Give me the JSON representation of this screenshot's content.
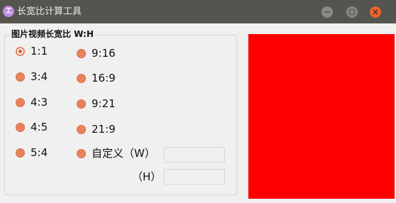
{
  "window": {
    "title": "长宽比计算工具",
    "icon_text": "工",
    "buttons": {
      "minimize_icon": "minimize-icon",
      "maximize_icon": "maximize-icon",
      "close_icon": "close-icon"
    }
  },
  "group": {
    "title": "图片视频长宽比 W:H",
    "options": [
      {
        "label": "1:1",
        "checked": true
      },
      {
        "label": "3:4",
        "checked": false
      },
      {
        "label": "4:3",
        "checked": false
      },
      {
        "label": "4:5",
        "checked": false
      },
      {
        "label": "5:4",
        "checked": false
      },
      {
        "label": "9:16",
        "checked": false
      },
      {
        "label": "16:9",
        "checked": false
      },
      {
        "label": "9:21",
        "checked": false
      },
      {
        "label": "21:9",
        "checked": false
      },
      {
        "label": "自定义（W）",
        "checked": false
      }
    ],
    "height_label": "（H）",
    "custom_width_value": "",
    "custom_height_value": ""
  },
  "preview": {
    "color": "#ff0000"
  },
  "colors": {
    "titlebar": "#55544f",
    "accent": "#e8825c",
    "close": "#e8672d"
  }
}
